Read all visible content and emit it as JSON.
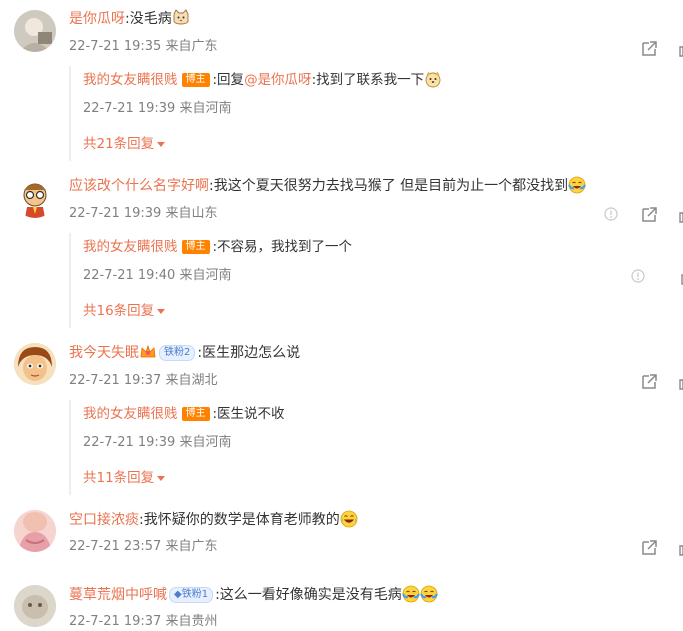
{
  "comments": [
    {
      "user": "是你瓜呀",
      "text": ":没毛病",
      "meta": "22-7-21 19:35 来自广东",
      "reply": {
        "user": "我的女友瞒很贱",
        "badge": "博主",
        "prefix": ":回复",
        "mention": "@是你瓜呀",
        "text": ":找到了联系我一下"
      },
      "reply_meta": "22-7-21 19:39 来自河南",
      "more": "共21条回复"
    },
    {
      "user": "应该改个什么名字好啊",
      "text": ":我这个夏天很努力去找马猴了  但是目前为止一个都没找到",
      "meta": "22-7-21 19:39 来自山东",
      "reply": {
        "user": "我的女友瞒很贱",
        "badge": "博主",
        "text": ":不容易，我找到了一个"
      },
      "reply_meta": "22-7-21 19:40 来自河南",
      "more": "共16条回复"
    },
    {
      "user": "我今天失眠",
      "fan_badge": "铁粉2",
      "text": ":医生那边怎么说",
      "meta": "22-7-21 19:37 来自湖北",
      "reply": {
        "user": "我的女友瞒很贱",
        "badge": "博主",
        "text": ":医生说不收"
      },
      "reply_meta": "22-7-21 19:39 来自河南",
      "more": "共11条回复"
    },
    {
      "user": "空口接浓痰",
      "text": ":我怀疑你的数学是体育老师教的",
      "meta": "22-7-21 23:57 来自广东"
    },
    {
      "user": "蔓草荒烟中呼喊",
      "fan_badge": "铁粉1",
      "text": ":这么一看好像确实是没有毛病",
      "meta": "22-7-21 19:37 来自贵州"
    }
  ],
  "icons": {
    "share": "share-icon",
    "like": "thumbs-up-icon",
    "report": "report-icon"
  },
  "colors": {
    "username": "#eb7350",
    "meta": "#808080",
    "owner_badge": "#ff8200"
  }
}
